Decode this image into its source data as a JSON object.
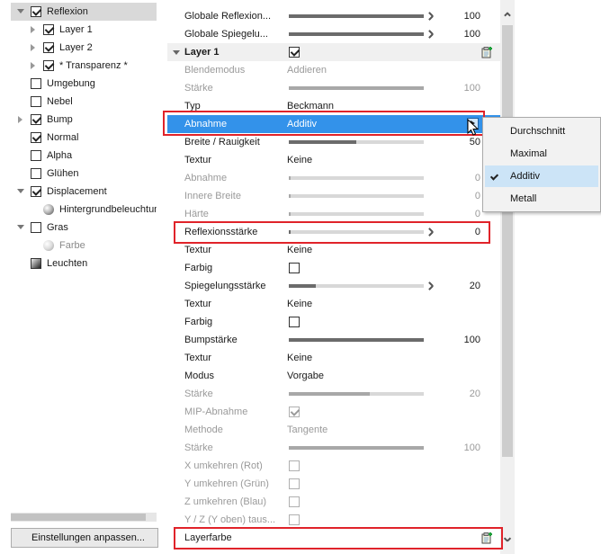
{
  "tree": {
    "items": [
      {
        "label": "Reflexion",
        "checked": true,
        "arrow": "exp",
        "indent": 0,
        "selected": true,
        "kind": "check"
      },
      {
        "label": "Layer 1",
        "checked": true,
        "arrow": "col",
        "indent": 1,
        "kind": "check"
      },
      {
        "label": "Layer 2",
        "checked": true,
        "arrow": "col",
        "indent": 1,
        "kind": "check"
      },
      {
        "label": "* Transparenz *",
        "checked": true,
        "arrow": "col",
        "indent": 1,
        "kind": "check"
      },
      {
        "label": "Umgebung",
        "checked": false,
        "arrow": "none",
        "indent": 0,
        "kind": "check"
      },
      {
        "label": "Nebel",
        "checked": false,
        "arrow": "none",
        "indent": 0,
        "kind": "check"
      },
      {
        "label": "Bump",
        "checked": true,
        "arrow": "col",
        "indent": 0,
        "kind": "check"
      },
      {
        "label": "Normal",
        "checked": true,
        "arrow": "none",
        "indent": 0,
        "kind": "check"
      },
      {
        "label": "Alpha",
        "checked": false,
        "arrow": "none",
        "indent": 0,
        "kind": "check"
      },
      {
        "label": "Glühen",
        "checked": false,
        "arrow": "none",
        "indent": 0,
        "kind": "check"
      },
      {
        "label": "Displacement",
        "checked": true,
        "arrow": "exp",
        "indent": 0,
        "kind": "check"
      },
      {
        "label": "Hintergrundbeleuchtung",
        "arrow": "none",
        "indent": 1,
        "kind": "sphere"
      },
      {
        "label": "Gras",
        "checked": false,
        "arrow": "exp",
        "indent": 0,
        "kind": "check"
      },
      {
        "label": "Farbe",
        "arrow": "none",
        "indent": 1,
        "kind": "sphere-light",
        "dim": true
      },
      {
        "label": "Leuchten",
        "arrow": "none",
        "indent": 0,
        "kind": "lamp"
      }
    ],
    "scroll_fraction": 0.93
  },
  "customize_button": "Einstellungen anpassen...",
  "props": {
    "rows": [
      {
        "type": "slider",
        "label": "Globale Reflexion...",
        "value": "100",
        "fill": 1.0,
        "chev": true
      },
      {
        "type": "slider",
        "label": "Globale Spiegelu...",
        "value": "100",
        "fill": 1.0,
        "chev": true
      },
      {
        "type": "group",
        "label": "Layer 1",
        "checked": true,
        "icon": true
      },
      {
        "type": "text",
        "label": "Blendemodus",
        "value": "Addieren",
        "dim": true
      },
      {
        "type": "slider",
        "label": "Stärke",
        "value": "100",
        "fill": 1.0,
        "dim": true
      },
      {
        "type": "text",
        "label": "Typ",
        "value": "Beckmann"
      },
      {
        "type": "dropdown",
        "label": "Abnahme",
        "value": "Additiv",
        "highlight": true
      },
      {
        "type": "slider",
        "label": "Breite / Rauigkeit",
        "value": "50",
        "fill": 0.5
      },
      {
        "type": "text",
        "label": "Textur",
        "value": "Keine"
      },
      {
        "type": "slider",
        "label": "Abnahme",
        "value": "0",
        "fill": 0.0,
        "dim": true
      },
      {
        "type": "slider",
        "label": "Innere Breite",
        "value": "0",
        "fill": 0.0,
        "dim": true
      },
      {
        "type": "slider",
        "label": "Härte",
        "value": "0",
        "fill": 0.0,
        "dim": true
      },
      {
        "type": "slider",
        "label": "Reflexionsstärke",
        "value": "0",
        "fill": 0.0,
        "chev": true
      },
      {
        "type": "text",
        "label": "Textur",
        "value": "Keine"
      },
      {
        "type": "check",
        "label": "Farbig",
        "checked": false
      },
      {
        "type": "slider",
        "label": "Spiegelungsstärke",
        "value": "20",
        "fill": 0.2,
        "chev": true
      },
      {
        "type": "text",
        "label": "Textur",
        "value": "Keine"
      },
      {
        "type": "check",
        "label": "Farbig",
        "checked": false
      },
      {
        "type": "slider",
        "label": "Bumpstärke",
        "value": "100",
        "fill": 1.0
      },
      {
        "type": "text",
        "label": "Textur",
        "value": "Keine"
      },
      {
        "type": "text",
        "label": "Modus",
        "value": "Vorgabe"
      },
      {
        "type": "slider",
        "label": "Stärke",
        "value": "20",
        "fill": 0.6,
        "dim": true
      },
      {
        "type": "check",
        "label": "MIP-Abnahme",
        "checked": true,
        "dim": true
      },
      {
        "type": "text",
        "label": "Methode",
        "value": "Tangente",
        "dim": true
      },
      {
        "type": "slider",
        "label": "Stärke",
        "value": "100",
        "fill": 1.0,
        "dim": true
      },
      {
        "type": "check",
        "label": "X umkehren (Rot)",
        "checked": false,
        "dim": true
      },
      {
        "type": "check",
        "label": "Y umkehren (Grün)",
        "checked": false,
        "dim": true
      },
      {
        "type": "check",
        "label": "Z umkehren (Blau)",
        "checked": false,
        "dim": true
      },
      {
        "type": "check",
        "label": "Y / Z (Y oben) taus...",
        "checked": false,
        "dim": true
      },
      {
        "type": "layer",
        "label": "Layerfarbe",
        "icon": true
      }
    ]
  },
  "dropdown_menu": {
    "items": [
      "Durchschnitt",
      "Maximal",
      "Additiv",
      "Metall"
    ],
    "selected": "Additiv"
  },
  "colors": {
    "highlight": "#3392ea",
    "annotation": "#e0232a",
    "menu_selected": "#cce4f7"
  },
  "icons": {
    "layer_add": "clipboard-plus-icon",
    "dropdown": "chevron-right-icon",
    "slider_stepper": "double-chevron-icon"
  }
}
